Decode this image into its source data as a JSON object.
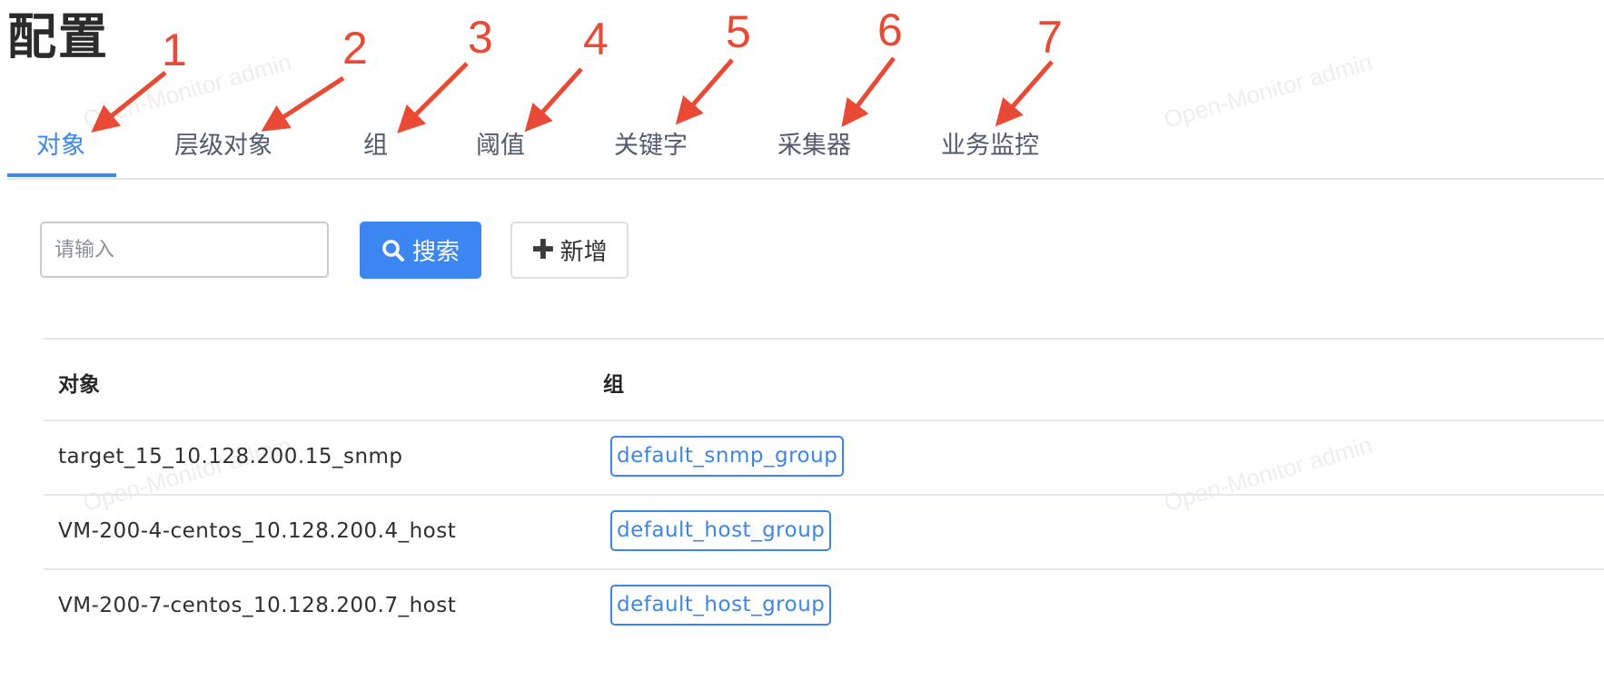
{
  "page": {
    "title": "配置"
  },
  "tabs": [
    {
      "label": "对象",
      "active": true
    },
    {
      "label": "层级对象",
      "active": false
    },
    {
      "label": "组",
      "active": false
    },
    {
      "label": "阈值",
      "active": false
    },
    {
      "label": "关键字",
      "active": false
    },
    {
      "label": "采集器",
      "active": false
    },
    {
      "label": "业务监控",
      "active": false
    }
  ],
  "annotations": [
    "1",
    "2",
    "3",
    "4",
    "5",
    "6",
    "7"
  ],
  "annotation_color": "#e84a35",
  "toolbar": {
    "search_placeholder": "请输入",
    "search_value": "",
    "search_label": "搜索",
    "search_icon": "search-icon",
    "add_label": "新增",
    "add_icon": "plus-icon"
  },
  "table": {
    "headers": [
      "对象",
      "组"
    ],
    "rows": [
      {
        "object": "target_15_10.128.200.15_snmp",
        "group": "default_snmp_group"
      },
      {
        "object": "VM-200-4-centos_10.128.200.4_host",
        "group": "default_host_group"
      },
      {
        "object": "VM-200-7-centos_10.128.200.7_host",
        "group": "default_host_group"
      }
    ]
  },
  "watermark": "Open-Monitor admin",
  "colors": {
    "accent": "#3b86e6",
    "primary_button": "#3b86f0",
    "annotation": "#e84a35"
  }
}
